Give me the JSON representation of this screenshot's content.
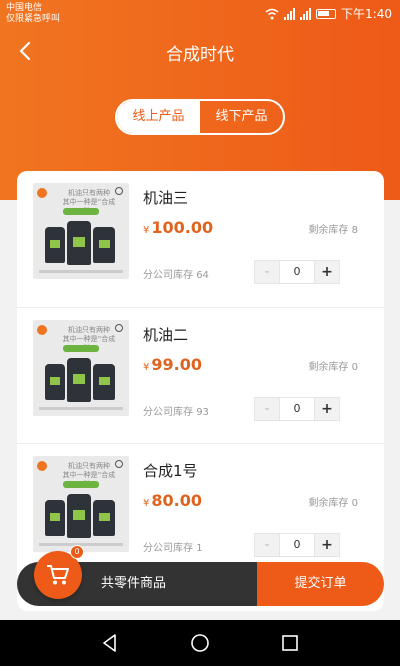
{
  "status_bar": {
    "carrier": "中国电信",
    "carrier_sub": "仅限紧急呼叫",
    "time": "下午1:40"
  },
  "header": {
    "title": "合成时代"
  },
  "segment": {
    "online": "线上产品",
    "offline": "线下产品",
    "selected": "线上产品"
  },
  "thumbnail": {
    "headline_1": "机油只有两种",
    "headline_2": "其中一种是“合成油”"
  },
  "products": [
    {
      "name": "机油三",
      "currency": "¥",
      "price": "100.00",
      "remain_label": "剩余库存",
      "remain": "8",
      "branch_label": "分公司库存",
      "branch": "64",
      "minus": "-",
      "qty": "0",
      "plus": "+"
    },
    {
      "name": "机油二",
      "currency": "¥",
      "price": "99.00",
      "remain_label": "剩余库存",
      "remain": "0",
      "branch_label": "分公司库存",
      "branch": "93",
      "minus": "-",
      "qty": "0",
      "plus": "+"
    },
    {
      "name": "合成1号",
      "currency": "¥",
      "price": "80.00",
      "remain_label": "剩余库存",
      "remain": "0",
      "branch_label": "分公司库存",
      "branch": "1",
      "minus": "-",
      "qty": "0",
      "plus": "+"
    }
  ],
  "footer": {
    "cart_count": "0",
    "cart_label": "共零件商品",
    "submit_label": "提交订单"
  },
  "colors": {
    "accent": "#ee5a17",
    "dark_bar": "#333333",
    "price": "#e0641f"
  },
  "icons": [
    "wifi-icon",
    "signal-icon",
    "battery-icon",
    "back-icon",
    "cart-icon",
    "nav-back-icon",
    "nav-home-icon",
    "nav-recent-icon"
  ]
}
